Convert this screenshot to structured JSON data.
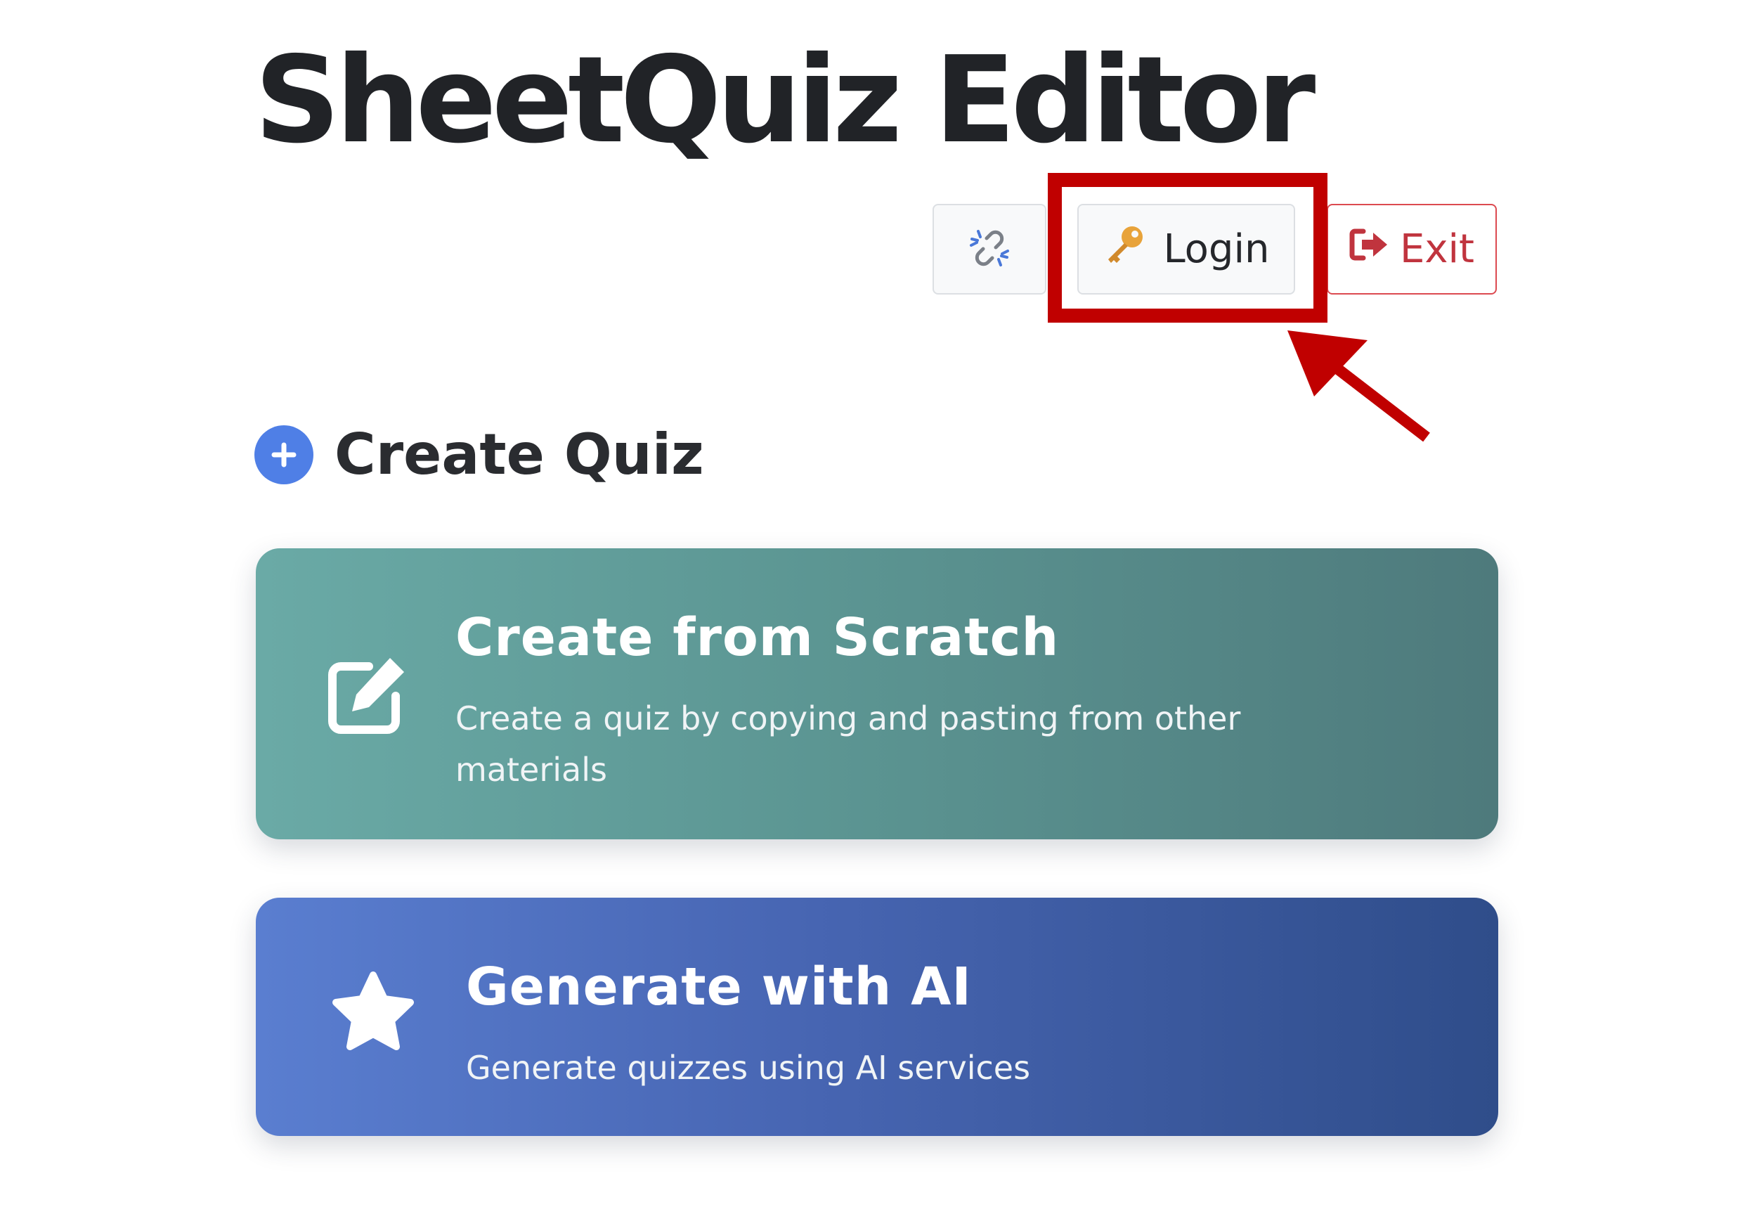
{
  "header": {
    "title": "SheetQuiz Editor"
  },
  "toolbar": {
    "link_icon": "unlink-icon",
    "login_label": "Login",
    "login_icon": "key-icon",
    "exit_label": "Exit",
    "exit_icon": "sign-out-icon"
  },
  "annotation": {
    "highlight_color": "#c00000",
    "target": "login-button"
  },
  "section": {
    "title": "Create Quiz",
    "icon": "plus-circle-icon",
    "icon_color": "#4f7fe6"
  },
  "cards": [
    {
      "title": "Create from Scratch",
      "description": "Create a quiz by copying and pasting from other materials",
      "icon": "edit-icon",
      "color": "#5c9693"
    },
    {
      "title": "Generate with AI",
      "description": "Generate quizzes using AI services",
      "icon": "star-icon",
      "color": "#4765b2"
    }
  ]
}
